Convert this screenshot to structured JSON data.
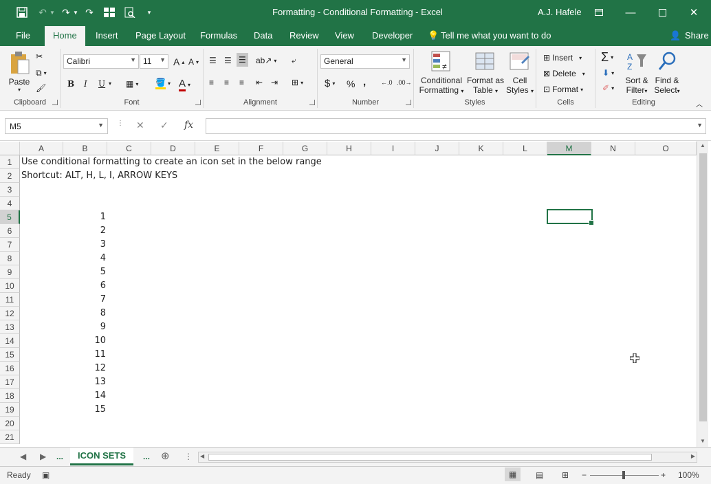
{
  "title": "Formatting - Conditional Formatting  -  Excel",
  "user": "A.J. Hafele",
  "menu": [
    "File",
    "Home",
    "Insert",
    "Page Layout",
    "Formulas",
    "Data",
    "Review",
    "View",
    "Developer"
  ],
  "tell_me": "Tell me what you want to do",
  "share": "Share",
  "ribbon": {
    "clipboard": {
      "label": "Clipboard",
      "paste": "Paste"
    },
    "font": {
      "label": "Font",
      "name": "Calibri",
      "size": "11",
      "bold": "B",
      "italic": "I",
      "underline": "U"
    },
    "alignment": {
      "label": "Alignment"
    },
    "number": {
      "label": "Number",
      "format": "General",
      "currency": "$",
      "percent": "%",
      "comma": ","
    },
    "styles": {
      "label": "Styles",
      "conditional": [
        "Conditional",
        "Formatting"
      ],
      "format_table": [
        "Format as",
        "Table"
      ],
      "cell_styles": [
        "Cell",
        "Styles"
      ]
    },
    "cells": {
      "label": "Cells",
      "insert": "Insert",
      "delete": "Delete",
      "format": "Format"
    },
    "editing": {
      "label": "Editing",
      "sort": [
        "Sort &",
        "Filter"
      ],
      "find": [
        "Find &",
        "Select"
      ]
    }
  },
  "namebox": "M5",
  "fx": "fx",
  "columns": [
    "A",
    "B",
    "C",
    "D",
    "E",
    "F",
    "G",
    "H",
    "I",
    "J",
    "K",
    "L",
    "M",
    "N",
    "O"
  ],
  "selected_column": "M",
  "rows": [
    "1",
    "2",
    "3",
    "4",
    "5",
    "6",
    "7",
    "8",
    "9",
    "10",
    "11",
    "12",
    "13",
    "14",
    "15",
    "16",
    "17",
    "18",
    "19",
    "20",
    "21"
  ],
  "selected_row": "5",
  "cells": {
    "A1": "Use conditional formatting to create an icon set in the below range",
    "A2": "Shortcut: ALT, H, L, I, ARROW KEYS",
    "B_values": [
      "1",
      "2",
      "3",
      "4",
      "5",
      "6",
      "7",
      "8",
      "9",
      "10",
      "11",
      "12",
      "13",
      "14",
      "15"
    ]
  },
  "sheet_tab": "ICON SETS",
  "sheet_more": "...",
  "status": {
    "ready": "Ready",
    "zoom": "100%"
  },
  "colors": {
    "accent": "#217346"
  }
}
